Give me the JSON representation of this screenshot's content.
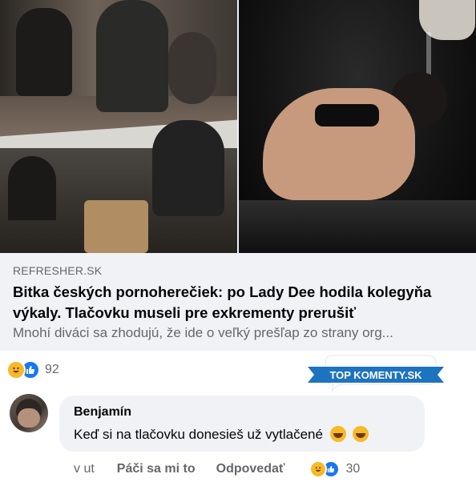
{
  "link_preview": {
    "domain": "REFRESHER.SK",
    "headline": "Bitka českých pornoherečiek: po Lady Dee hodila kolegyňa výkaly. Tlačovku museli pre exkrementy prerušiť",
    "description": "Mnohí diváci sa zhodujú, že ide o veľký prešľap zo strany org..."
  },
  "post_reactions": {
    "icons": [
      "haha-icon",
      "like-icon"
    ],
    "count": "92"
  },
  "badge": {
    "text": "TOP KOMENTY.SK",
    "colors": {
      "bubble": "#ffffff",
      "ribbon": "#1e73be"
    }
  },
  "comment": {
    "author": "Benjamín",
    "text": "Keď si na tlačovku donesieš už vytlačené",
    "emojis": [
      "rofl-emoji",
      "rofl-emoji"
    ],
    "time": "v ut",
    "like_label": "Páči sa mi to",
    "reply_label": "Odpovedať",
    "reactions": [
      "haha-icon",
      "like-icon"
    ],
    "reaction_count": "30"
  },
  "colors": {
    "card_bg": "#f0f2f5",
    "secondary_text": "#65676b",
    "primary_text": "#050505",
    "like_blue": "#1877f2",
    "haha_yellow": "#f7b928"
  }
}
